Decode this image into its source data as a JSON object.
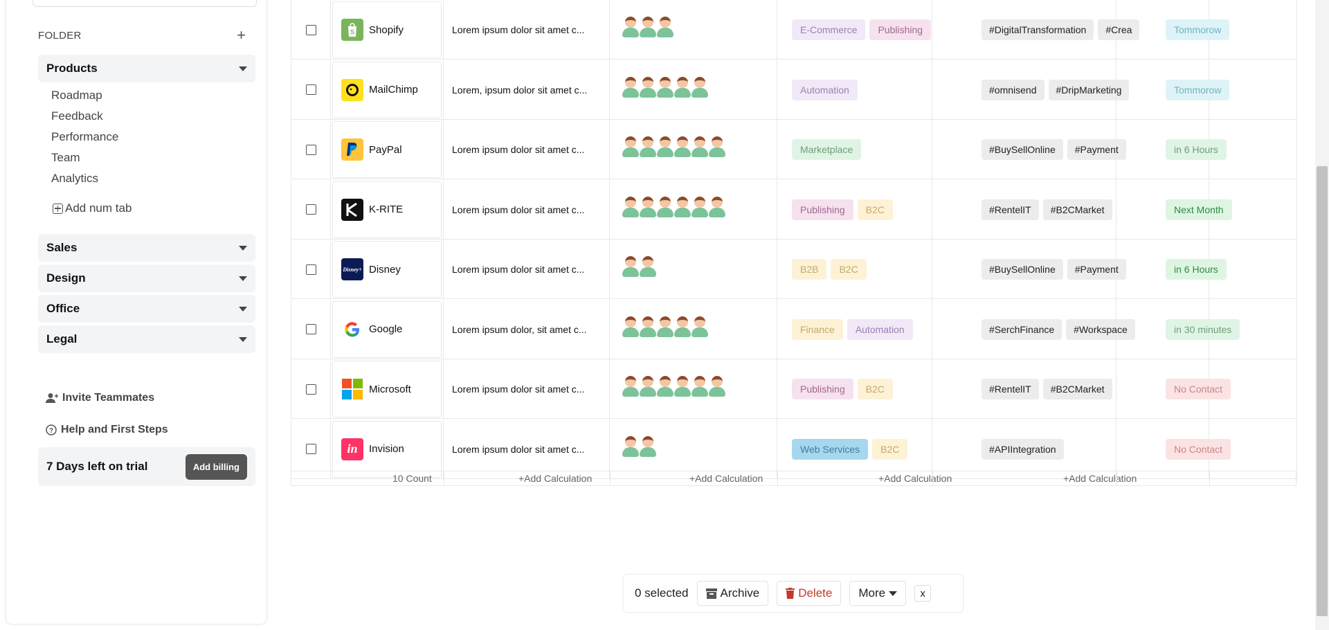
{
  "sidebar": {
    "folder_title": "FOLDER",
    "products": {
      "label": "Products",
      "items": [
        "Roadmap",
        "Feedback",
        "Performance",
        "Team",
        "Analytics"
      ],
      "add_tab": "Add num tab"
    },
    "groups": [
      "Sales",
      "Design",
      "Office",
      "Legal"
    ],
    "invite": "Invite Teammates",
    "help": "Help and First Steps",
    "trial_text": "7 Days left on trial",
    "billing_button": "Add billing"
  },
  "rows": [
    {
      "name": "Shopify",
      "logo": "shopify-logo",
      "logo_color": "#7ab55c",
      "desc": "Lorem ipsum dolor sit amet c...",
      "avatars": 3,
      "tags": [
        {
          "t": "E-Commerce",
          "bg": "#f1e9f7",
          "c": "#9b7fb2"
        },
        {
          "t": "Publishing",
          "bg": "#f6e1ef",
          "c": "#a1688e"
        }
      ],
      "hashes": [
        "#DigitalTransformation",
        "#Crea"
      ],
      "status": {
        "t": "Tommorow",
        "bg": "#ddf3f7",
        "c": "#6fb4c3"
      }
    },
    {
      "name": "MailChimp",
      "logo": "mailchimp-logo",
      "logo_color": "#ffe01b",
      "desc": "Lorem, ipsum dolor sit amet c...",
      "avatars": 5,
      "tags": [
        {
          "t": "Automation",
          "bg": "#f1e9f7",
          "c": "#9b7fb2"
        }
      ],
      "hashes": [
        "#omnisend",
        "#DripMarketing"
      ],
      "status": {
        "t": "Tommorow",
        "bg": "#ddf3f7",
        "c": "#6fb4c3"
      }
    },
    {
      "name": "PayPal",
      "logo": "paypal-logo",
      "logo_color": "#ffc439",
      "desc": "Lorem ipsum dolor sit amet c...",
      "avatars": 6,
      "tags": [
        {
          "t": "Marketplace",
          "bg": "#e0f4e5",
          "c": "#6a9f79"
        }
      ],
      "hashes": [
        "#BuySellOnline",
        "#Payment"
      ],
      "status": {
        "t": "in 6 Hours",
        "bg": "#e0f4e5",
        "c": "#6a9f79"
      }
    },
    {
      "name": "K-RITE",
      "logo": "krite-logo",
      "logo_color": "#111111",
      "desc": "Lorem ipsum dolor sit amet c...",
      "avatars": 6,
      "tags": [
        {
          "t": "Publishing",
          "bg": "#f6e1ef",
          "c": "#a1688e"
        },
        {
          "t": "B2C",
          "bg": "#fdf2d6",
          "c": "#c7a867"
        }
      ],
      "hashes": [
        "#RentelIT",
        "#B2CMarket"
      ],
      "status": {
        "t": "Next Month",
        "bg": "#def5e2",
        "c": "#2e8b45"
      }
    },
    {
      "name": "Disney",
      "logo": "disney-logo",
      "logo_color": "#0b1c55",
      "desc": "Lorem ipsum dolor sit amet c...",
      "avatars": 2,
      "tags": [
        {
          "t": "B2B",
          "bg": "#fdf2d6",
          "c": "#c7a867"
        },
        {
          "t": "B2C",
          "bg": "#fdf2d6",
          "c": "#c7a867"
        }
      ],
      "hashes": [
        "#BuySellOnline",
        "#Payment"
      ],
      "status": {
        "t": "in 6 Hours",
        "bg": "#def5e2",
        "c": "#2e8b45"
      }
    },
    {
      "name": "Google",
      "logo": "google-logo",
      "logo_color": "#ffffff",
      "desc": "Lorem ipsum dolor, sit amet c...",
      "avatars": 5,
      "tags": [
        {
          "t": "Finance",
          "bg": "#fdf2d6",
          "c": "#c7a867"
        },
        {
          "t": "Automation",
          "bg": "#f1e9f7",
          "c": "#9b7fb2"
        }
      ],
      "hashes": [
        "#SerchFinance",
        "#Workspace"
      ],
      "status": {
        "t": "in 30 minutes",
        "bg": "#e0f4e5",
        "c": "#6a9f79"
      }
    },
    {
      "name": "Microsoft",
      "logo": "microsoft-logo",
      "logo_color": "#ffffff",
      "desc": "Lorem ipsum dolor sit amet c...",
      "avatars": 6,
      "tags": [
        {
          "t": "Publishing",
          "bg": "#f6e1ef",
          "c": "#a1688e"
        },
        {
          "t": "B2C",
          "bg": "#fdf2d6",
          "c": "#c7a867"
        }
      ],
      "hashes": [
        "#RentelIT",
        "#B2CMarket"
      ],
      "status": {
        "t": "No Contact",
        "bg": "#fbe3e3",
        "c": "#c98686"
      }
    },
    {
      "name": "Invision",
      "logo": "invision-logo",
      "logo_color": "#ff3366",
      "desc": "Lorem ipsum dolor sit amet c...",
      "avatars": 2,
      "tags": [
        {
          "t": "Web Services",
          "bg": "#a5d8ee",
          "c": "#3d7e9c"
        },
        {
          "t": "B2C",
          "bg": "#fdf2d6",
          "c": "#c7a867"
        }
      ],
      "hashes": [
        "#APIIntegration"
      ],
      "status": {
        "t": "No Contact",
        "bg": "#fbe3e3",
        "c": "#c98686"
      }
    }
  ],
  "footer": {
    "count": "10 Count",
    "calc": "+Add Calculation"
  },
  "action_bar": {
    "selected": "0 selected",
    "archive": "Archive",
    "delete": "Delete",
    "more": "More",
    "close": "x"
  }
}
